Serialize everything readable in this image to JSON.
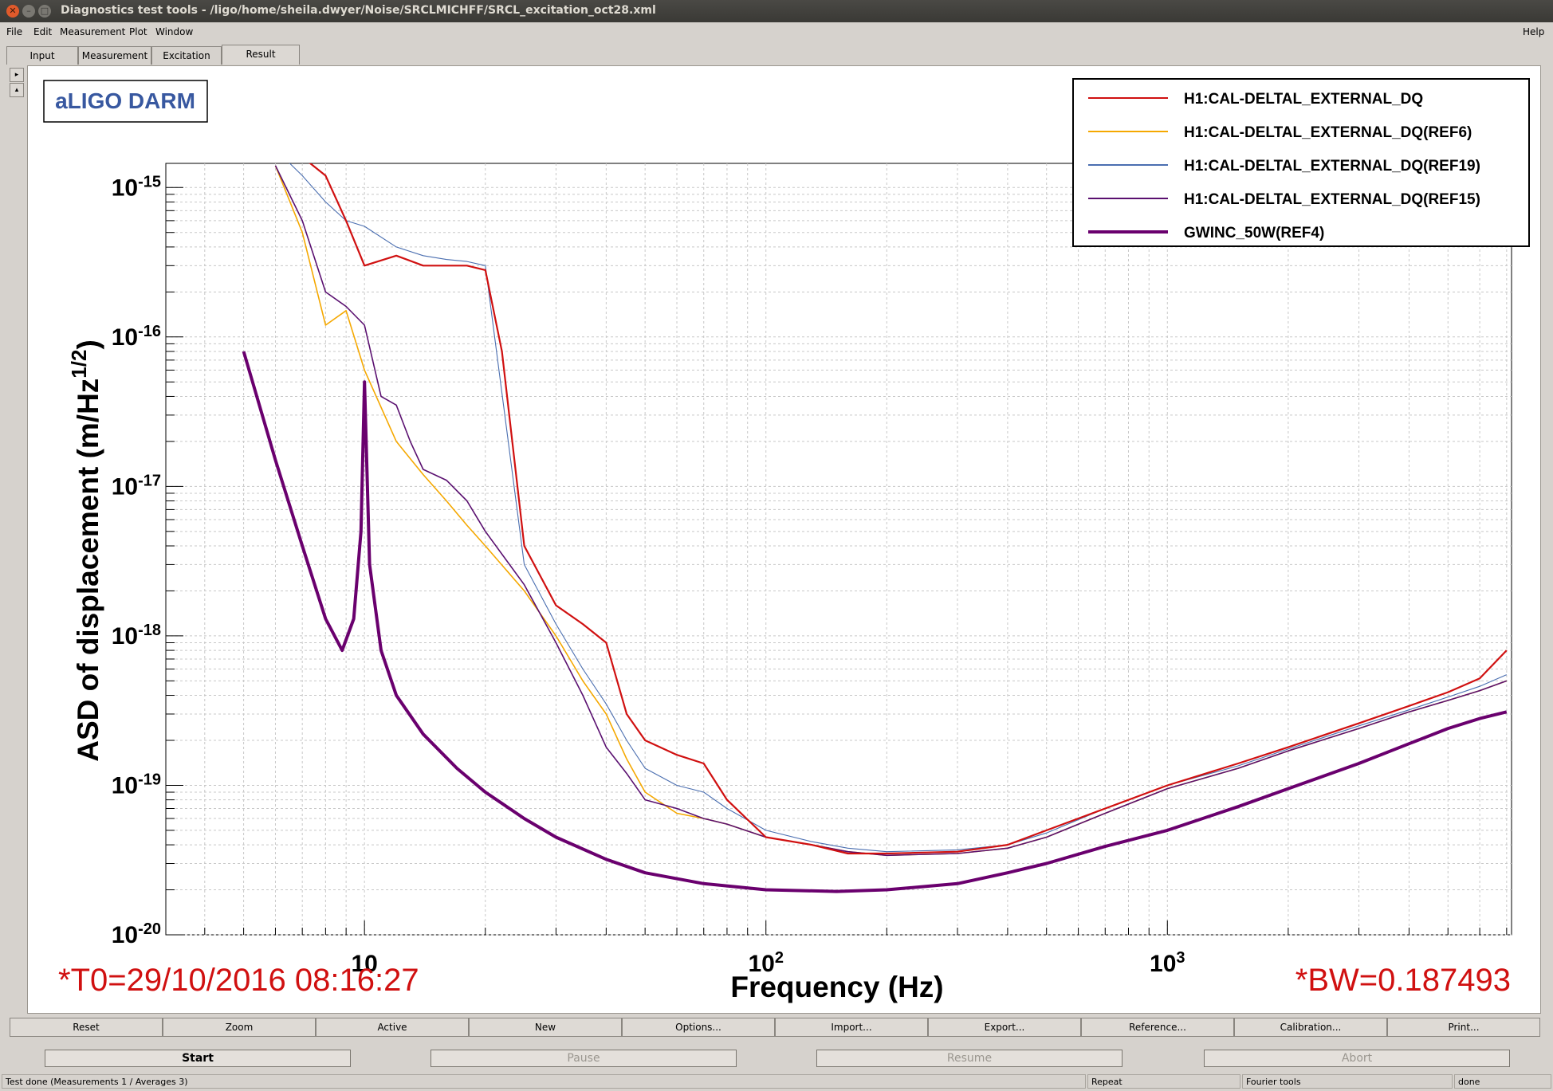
{
  "window": {
    "title": "Diagnostics test tools - /ligo/home/sheila.dwyer/Noise/SRCLMICHFF/SRCL_excitation_oct28.xml"
  },
  "menu": {
    "file": "File",
    "edit": "Edit",
    "measurement": "Measurement",
    "plot": "Plot",
    "window": "Window",
    "help": "Help"
  },
  "tabs": [
    "Input",
    "Measurement",
    "Excitation",
    "Result"
  ],
  "plot": {
    "badge": "aLIGO DARM",
    "t0": "*T0=29/10/2016 08:16:27",
    "bw": "*BW=0.187493"
  },
  "chart_data": {
    "type": "line",
    "xlabel": "Frequency (Hz)",
    "ylabel": "ASD of displacement (m/Hz^(1/2))",
    "x_scale": "log",
    "y_scale": "log",
    "xlim": [
      3.2,
      7200
    ],
    "ylim": [
      1e-20,
      1.45e-15
    ],
    "x_tick_labels": [
      "10",
      "10^2",
      "10^3"
    ],
    "y_tick_labels": [
      "10^-15",
      "10^-16",
      "10^-17",
      "10^-18",
      "10^-19",
      "10^-20"
    ],
    "grid": true,
    "legend_position": "top-right",
    "series": [
      {
        "name": "H1:CAL-DELTAL_EXTERNAL_DQ",
        "color": "#d01010",
        "x": [
          6,
          7,
          8,
          9,
          10,
          12,
          14,
          16,
          18,
          20,
          22,
          25,
          30,
          35,
          40,
          45,
          50,
          60,
          70,
          80,
          100,
          130,
          160,
          200,
          300,
          400,
          500,
          700,
          1000,
          1500,
          2000,
          3000,
          4000,
          5000,
          6000,
          7000
        ],
        "y": [
          2e-15,
          1.6e-15,
          1.2e-15,
          6e-16,
          3e-16,
          3.5e-16,
          3e-16,
          3e-16,
          3e-16,
          2.8e-16,
          8e-17,
          4e-18,
          1.6e-18,
          1.2e-18,
          9e-19,
          3e-19,
          2e-19,
          1.6e-19,
          1.4e-19,
          8e-20,
          4.5e-20,
          4e-20,
          3.5e-20,
          3.5e-20,
          3.6e-20,
          4e-20,
          5e-20,
          7e-20,
          1e-19,
          1.4e-19,
          1.8e-19,
          2.6e-19,
          3.4e-19,
          4.2e-19,
          5.2e-19,
          8e-19
        ]
      },
      {
        "name": "H1:CAL-DELTAL_EXTERNAL_DQ(REF6)",
        "color": "#f5a800",
        "x": [
          6,
          7,
          8,
          9,
          10,
          12,
          14,
          16,
          18,
          20,
          25,
          30,
          35,
          40,
          45,
          50,
          60,
          70,
          80,
          100,
          130,
          160,
          200,
          300,
          400,
          500,
          700,
          1000,
          1500,
          2000,
          3000,
          4000,
          5000,
          6000,
          7000
        ],
        "y": [
          1.4e-15,
          5e-16,
          1.2e-16,
          1.5e-16,
          6e-17,
          2e-17,
          1.2e-17,
          8e-18,
          5.5e-18,
          4e-18,
          2e-18,
          1e-18,
          5e-19,
          3e-19,
          1.5e-19,
          9e-20,
          6.5e-20,
          6e-20,
          5.5e-20,
          4.5e-20,
          4e-20,
          3.6e-20,
          3.4e-20,
          3.5e-20,
          3.8e-20,
          4.5e-20,
          6.5e-20,
          9.5e-20,
          1.3e-19,
          1.7e-19,
          2.4e-19,
          3.1e-19,
          3.7e-19,
          4.3e-19,
          5e-19
        ]
      },
      {
        "name": "H1:CAL-DELTAL_EXTERNAL_DQ(REF19)",
        "color": "#4a6eb0",
        "x": [
          6,
          7,
          8,
          9,
          10,
          12,
          14,
          16,
          18,
          20,
          25,
          30,
          35,
          40,
          45,
          50,
          60,
          70,
          80,
          100,
          130,
          160,
          200,
          300,
          400,
          500,
          700,
          1000,
          1500,
          2000,
          3000,
          4000,
          5000,
          6000,
          7000
        ],
        "y": [
          1.8e-15,
          1.2e-15,
          8e-16,
          6e-16,
          5.5e-16,
          4e-16,
          3.5e-16,
          3.3e-16,
          3.2e-16,
          3e-16,
          3e-18,
          1.2e-18,
          6e-19,
          3.5e-19,
          2e-19,
          1.3e-19,
          1e-19,
          9e-20,
          7e-20,
          5e-20,
          4.2e-20,
          3.8e-20,
          3.6e-20,
          3.7e-20,
          4e-20,
          4.8e-20,
          7e-20,
          1e-19,
          1.35e-19,
          1.75e-19,
          2.5e-19,
          3.2e-19,
          3.9e-19,
          4.6e-19,
          5.5e-19
        ]
      },
      {
        "name": "H1:CAL-DELTAL_EXTERNAL_DQ(REF15)",
        "color": "#5a1070",
        "x": [
          6,
          7,
          8,
          9,
          10,
          11,
          12,
          13,
          14,
          16,
          18,
          20,
          25,
          30,
          35,
          40,
          45,
          50,
          60,
          70,
          80,
          100,
          130,
          160,
          200,
          300,
          400,
          500,
          700,
          1000,
          1500,
          2000,
          3000,
          4000,
          5000,
          6000,
          7000
        ],
        "y": [
          1.4e-15,
          6e-16,
          2e-16,
          1.6e-16,
          1.2e-16,
          4e-17,
          3.5e-17,
          2e-17,
          1.3e-17,
          1.1e-17,
          8e-18,
          5e-18,
          2.2e-18,
          9e-19,
          4e-19,
          1.8e-19,
          1.2e-19,
          8e-20,
          7e-20,
          6e-20,
          5.5e-20,
          4.5e-20,
          4e-20,
          3.6e-20,
          3.4e-20,
          3.5e-20,
          3.8e-20,
          4.5e-20,
          6.5e-20,
          9.5e-20,
          1.3e-19,
          1.7e-19,
          2.4e-19,
          3.1e-19,
          3.7e-19,
          4.3e-19,
          5e-19
        ]
      },
      {
        "name": "GWINC_50W(REF4)",
        "color": "#6a006e",
        "x": [
          5,
          6,
          7,
          8,
          8.8,
          9.4,
          9.8,
          10,
          10.3,
          11,
          12,
          14,
          17,
          20,
          25,
          30,
          40,
          50,
          70,
          100,
          150,
          200,
          300,
          400,
          500,
          700,
          1000,
          1500,
          2000,
          3000,
          4000,
          5000,
          6000,
          7000
        ],
        "y": [
          8e-17,
          1.5e-17,
          4e-18,
          1.3e-18,
          8e-19,
          1.3e-18,
          5e-18,
          5e-17,
          3e-18,
          8e-19,
          4e-19,
          2.2e-19,
          1.3e-19,
          9e-20,
          6e-20,
          4.5e-20,
          3.2e-20,
          2.6e-20,
          2.2e-20,
          2e-20,
          1.95e-20,
          2e-20,
          2.2e-20,
          2.6e-20,
          3e-20,
          3.9e-20,
          5e-20,
          7.2e-20,
          9.5e-20,
          1.4e-19,
          1.9e-19,
          2.4e-19,
          2.8e-19,
          3.1e-19
        ]
      }
    ]
  },
  "buttons": [
    "Reset",
    "Zoom",
    "Active",
    "New",
    "Options...",
    "Import...",
    "Export...",
    "Reference...",
    "Calibration...",
    "Print..."
  ],
  "controls": {
    "start": "Start",
    "pause": "Pause",
    "resume": "Resume",
    "abort": "Abort"
  },
  "status": {
    "message": "Test done (Measurements 1 / Averages 3)",
    "repeat": "Repeat",
    "fourier": "Fourier tools",
    "done": "done"
  }
}
